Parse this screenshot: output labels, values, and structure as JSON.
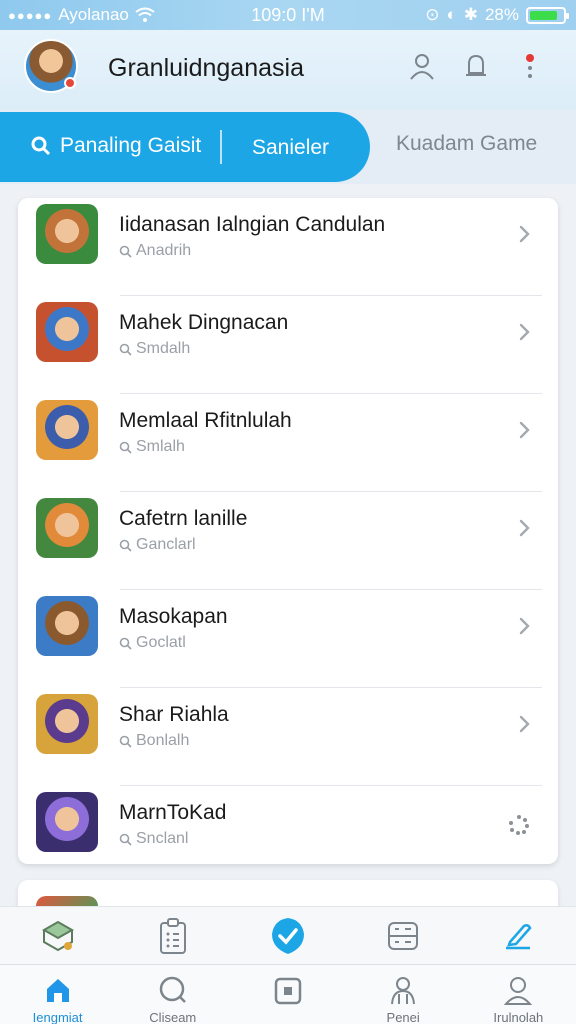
{
  "status_bar": {
    "carrier": "Ayolanao",
    "time": "109:0 I'M",
    "battery_text": "28%",
    "battery_level": 0.85
  },
  "header": {
    "title": "Granluidnganasia",
    "icons": [
      "user-icon",
      "bell-icon",
      "more-icon"
    ]
  },
  "tabs": {
    "active_label": "Panaling Gaisit",
    "second_label": "Sanieler",
    "third_label": "Kuadam Game"
  },
  "games": [
    {
      "title": "Iidanasan Ialngian Candulan",
      "sub": "Anadrih",
      "action": "chevron"
    },
    {
      "title": "Mahek Dingnacan",
      "sub": "Smdalh",
      "action": "chevron"
    },
    {
      "title": "Memlaal Rfitnlulah",
      "sub": "Smlalh",
      "action": "chevron"
    },
    {
      "title": "Cafetrn lanille",
      "sub": "Ganclarl",
      "action": "chevron"
    },
    {
      "title": "Masokapan",
      "sub": "Goclatl",
      "action": "chevron"
    },
    {
      "title": "Shar Riahla",
      "sub": "Bonlalh",
      "action": "chevron"
    },
    {
      "title": "MarnToKad",
      "sub": "Snclanl",
      "action": "spinner"
    }
  ],
  "bottom_nav": [
    {
      "label": "Iengmiat",
      "icon": "home-icon"
    },
    {
      "label": "Cliseam",
      "icon": "search-icon"
    },
    {
      "label": "",
      "icon": "square-icon"
    },
    {
      "label": "Penei",
      "icon": "people-icon"
    },
    {
      "label": "Irulnolah",
      "icon": "profile-icon"
    }
  ],
  "colors": {
    "accent": "#1da6e6",
    "header_bg": "#e7f3fb",
    "active_nav": "#1c8fd8"
  }
}
